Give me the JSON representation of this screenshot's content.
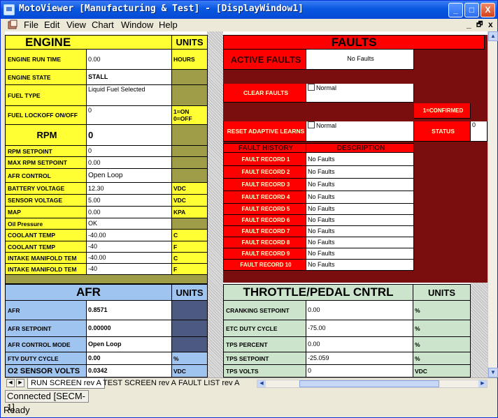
{
  "window": {
    "title": "MotoViewer [Manufacturing & Test] - [DisplayWindow1]",
    "controls": {
      "minimize": "_",
      "maximize": "□",
      "close": "X"
    }
  },
  "menu": {
    "items": [
      "File",
      "Edit",
      "View",
      "Chart",
      "Window",
      "Help"
    ],
    "mdi": [
      "_",
      "🗗",
      "x"
    ]
  },
  "engine": {
    "title": "ENGINE",
    "units_header": "UNITS",
    "rows": [
      {
        "label": "ENGINE RUN TIME",
        "value": "0.00",
        "unit": "HOURS"
      },
      {
        "label": "ENGINE STATE",
        "value": "STALL",
        "unit": ""
      },
      {
        "label": "FUEL TYPE",
        "value": "Liquid Fuel Selected",
        "unit": ""
      },
      {
        "label": "FUEL LOCKOFF ON/OFF",
        "value": "0",
        "unit": "1=ON\n0=OFF"
      },
      {
        "label": "RPM",
        "value": "0",
        "unit": ""
      },
      {
        "label": "RPM SETPOINT",
        "value": "0",
        "unit": ""
      },
      {
        "label": "MAX RPM SETPOINT",
        "value": "0.00",
        "unit": ""
      },
      {
        "label": "AFR CONTROL",
        "value": "Open Loop",
        "unit": ""
      },
      {
        "label": "BATTERY VOLTAGE",
        "value": "12.30",
        "unit": "VDC"
      },
      {
        "label": "SENSOR VOLTAGE",
        "value": "5.00",
        "unit": "VDC"
      },
      {
        "label": "MAP",
        "value": "0.00",
        "unit": "KPA"
      },
      {
        "label": "Oil Pressure",
        "value": "OK",
        "unit": ""
      },
      {
        "label": "COOLANT TEMP",
        "value": "-40.00",
        "unit": "C"
      },
      {
        "label": "COOLANT TEMP",
        "value": "-40",
        "unit": "F"
      },
      {
        "label": "INTAKE MANIFOLD TEM",
        "value": "-40.00",
        "unit": "C"
      },
      {
        "label": "INTAKE MANIFOLD TEM",
        "value": "-40",
        "unit": "F"
      }
    ]
  },
  "faults": {
    "title": "FAULTS",
    "active_label": "ACTIVE FAULTS",
    "active_value": "No Faults",
    "clear_label": "CLEAR FAULTS",
    "clear_value": "Normal",
    "confirmed_label": "1=CONFIRMED",
    "reset_label": "RESET ADAPTIVE LEARNS",
    "reset_value": "Normal",
    "status_label": "STATUS",
    "status_value": "0",
    "history_header": "FAULT HISTORY",
    "description_header": "DESCRIPTION",
    "records": [
      {
        "label": "FAULT RECORD 1",
        "value": "No Faults"
      },
      {
        "label": "FAULT RECORD 2",
        "value": "No Faults"
      },
      {
        "label": "FAULT RECORD 3",
        "value": "No Faults"
      },
      {
        "label": "FAULT RECORD 4",
        "value": "No Faults"
      },
      {
        "label": "FAULT RECORD 5",
        "value": "No Faults"
      },
      {
        "label": "FAULT RECORD 6",
        "value": "No Faults"
      },
      {
        "label": "FAULT RECORD 7",
        "value": "No Faults"
      },
      {
        "label": "FAULT RECORD 8",
        "value": "No Faults"
      },
      {
        "label": "FAULT RECORD 9",
        "value": "No Faults"
      },
      {
        "label": "FAULT RECORD 10",
        "value": "No Faults"
      }
    ]
  },
  "afr": {
    "title": "AFR",
    "units_header": "UNITS",
    "rows": [
      {
        "label": "AFR",
        "value": "0.8571",
        "unit": ""
      },
      {
        "label": "AFR SETPOINT",
        "value": "0.00000",
        "unit": ""
      },
      {
        "label": "AFR CONTROL MODE",
        "value": "Open Loop",
        "unit": ""
      },
      {
        "label": "FTV DUTY CYCLE",
        "value": "0.00",
        "unit": "%"
      },
      {
        "label": "O2 SENSOR VOLTS",
        "value": "0.0342",
        "unit": "VDC"
      }
    ]
  },
  "throttle": {
    "title": "THROTTLE/PEDAL CNTRL",
    "units_header": "UNITS",
    "rows": [
      {
        "label": "CRANKING SETPOINT",
        "value": "0.00",
        "unit": "%"
      },
      {
        "label": "ETC DUTY CYCLE",
        "value": "-75.00",
        "unit": "%"
      },
      {
        "label": "TPS PERCENT",
        "value": "0.00",
        "unit": "%"
      },
      {
        "label": "TPS SETPOINT",
        "value": "-25.059",
        "unit": "%"
      },
      {
        "label": "TPS VOLTS",
        "value": "0",
        "unit": "VDC"
      }
    ]
  },
  "tabs": [
    "RUN SCREEN rev A",
    "TEST SCREEN rev A",
    "FAULT LIST rev A"
  ],
  "status": {
    "connection": "Connected [SECM-1]",
    "state": "Ready"
  }
}
